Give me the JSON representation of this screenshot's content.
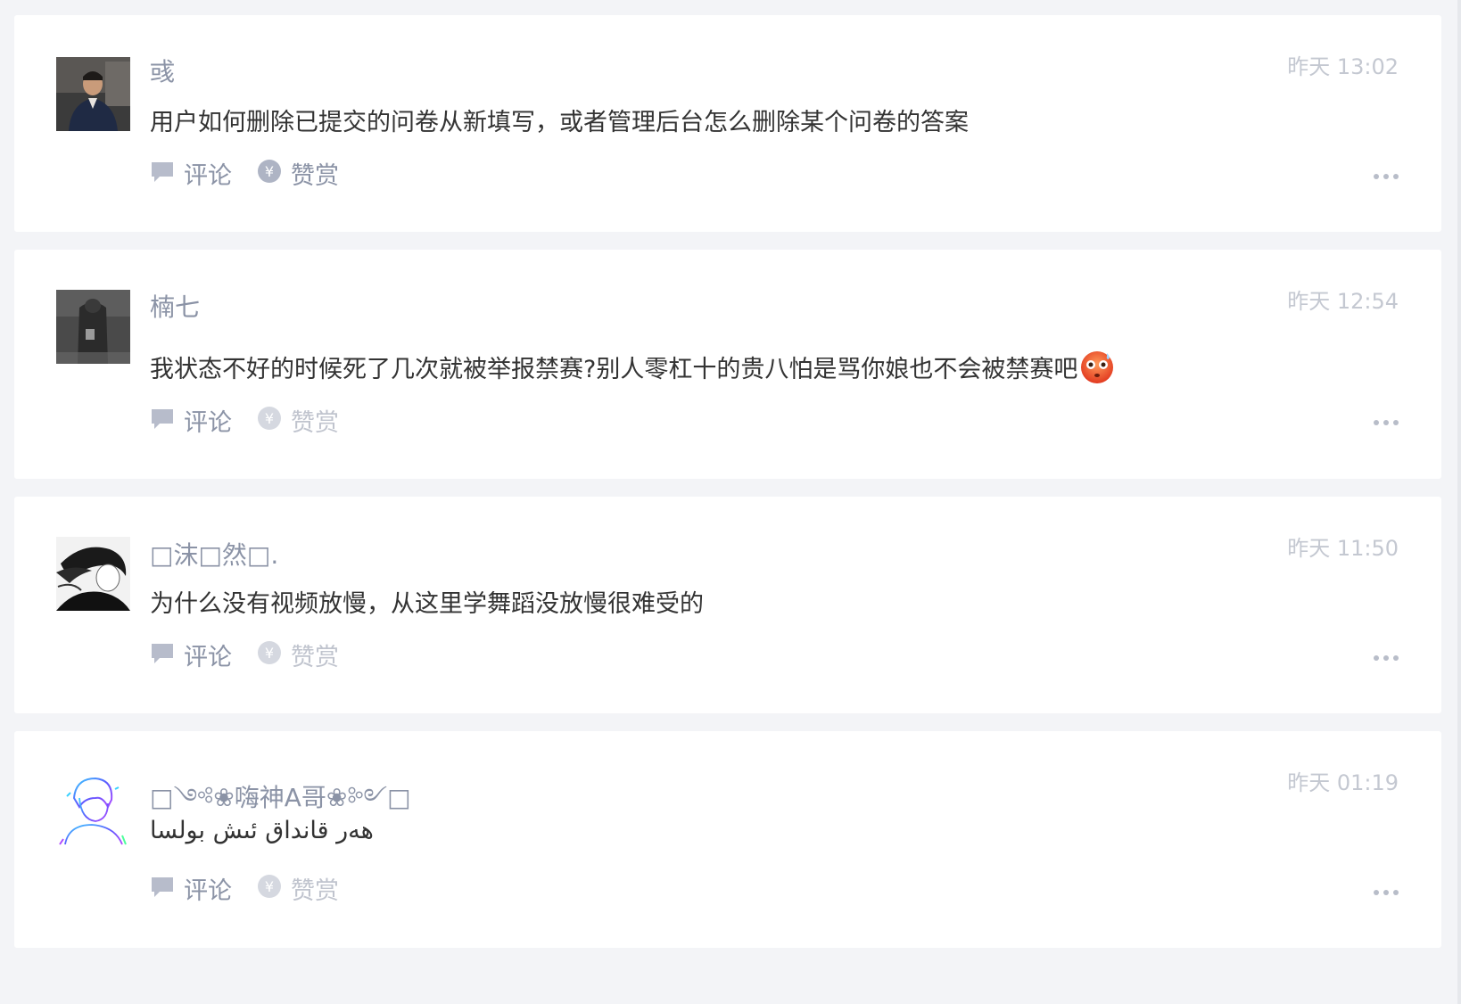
{
  "colors": {
    "background": "#f3f4f7",
    "card": "#ffffff",
    "name_text": "#8b93a6",
    "body_text": "#333333",
    "time_text": "#c4c8d1",
    "icon": "#b7bccb"
  },
  "actions": {
    "comment_label": "评论",
    "reward_label": "赞赏",
    "comment_icon": "speech-bubble-icon",
    "reward_icon": "yen-coin-icon",
    "more_icon": "ellipsis-icon"
  },
  "posts": [
    {
      "name": "彧",
      "time": "昨天 13:02",
      "content": "用户如何删除已提交的问卷从新填写，或者管理后台怎么删除某个问卷的答案",
      "reward_active": true
    },
    {
      "name": "楠七",
      "time": "昨天 12:54",
      "content": "我状态不好的时候死了几次就被举报禁赛?别人零杠十的贵八怕是骂你娘也不会被禁赛吧",
      "emoji": "flushed-face-icon",
      "reward_active": false
    },
    {
      "name": "□沫□然□.",
      "time": "昨天 11:50",
      "content": "为什么没有视频放慢，从这里学舞蹈没放慢很难受的",
      "reward_active": false
    },
    {
      "name": "□༺❀嗨神A哥❀༻□",
      "time": "昨天 01:19",
      "content": "هەر قانداق ئىش بولسا",
      "reward_active": false
    }
  ]
}
